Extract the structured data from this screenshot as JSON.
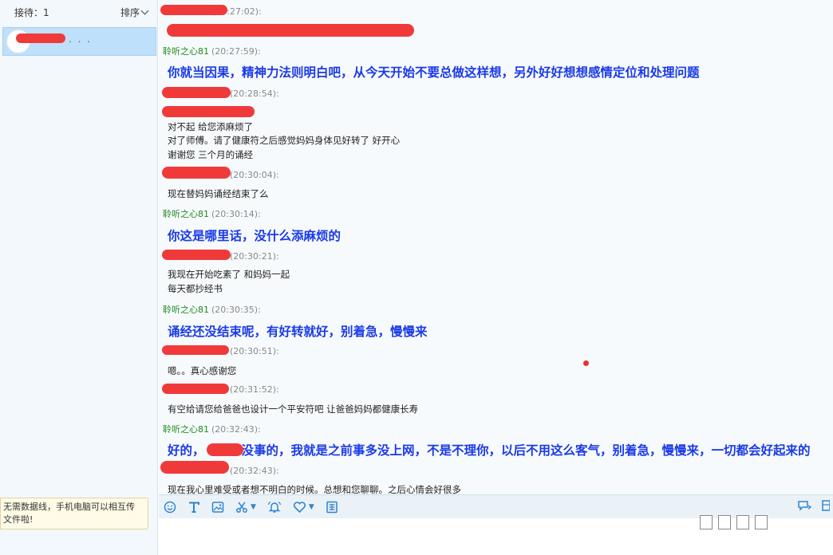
{
  "sidebar": {
    "reception_label": "接待：1",
    "sort_label": "排序",
    "contact_dots": ". . .",
    "tip_text": "无需数据线，手机电脑可以相互传文件啦!"
  },
  "messages": [
    {
      "sender": "",
      "time": "(20:27:02):",
      "lines": [],
      "big": []
    },
    {
      "sender": "聆听之心81",
      "time": "(20:27:59):",
      "lines": [],
      "big": [
        "你就当因果，精神力法则明白吧，从今天开始不要总做这样想，另外好好想想感情定位和处理问题"
      ]
    },
    {
      "sender": "",
      "time": "(20:28:54):",
      "lines": [
        "对不起 给您添麻烦了",
        "对了师傅。请了健康符之后感觉妈妈身体见好转了 好开心",
        "谢谢您 三个月的诵经"
      ],
      "big": []
    },
    {
      "sender": "",
      "time": "(20:30:04):",
      "lines": [
        "现在替妈妈诵经结束了么"
      ],
      "big": []
    },
    {
      "sender": "聆听之心81",
      "time": "(20:30:14):",
      "lines": [],
      "big": [
        "你这是哪里话，没什么添麻烦的"
      ]
    },
    {
      "sender": "",
      "time": "(20:30:21):",
      "lines": [
        "我现在开始吃素了 和妈妈一起",
        "每天都抄经书"
      ],
      "big": []
    },
    {
      "sender": "聆听之心81",
      "time": "(20:30:35):",
      "lines": [],
      "big": [
        "诵经还没结束呢，有好转就好，别着急，慢慢来"
      ]
    },
    {
      "sender": "",
      "time": "(20:30:51):",
      "lines": [
        "嗯。。真心感谢您"
      ],
      "big": []
    },
    {
      "sender": "",
      "time": "(20:31:52):",
      "lines": [
        "有空给请您给爸爸也设计一个平安符吧 让爸爸妈妈都健康长寿"
      ],
      "big": []
    },
    {
      "sender": "聆听之心81",
      "time": "(20:32:43):",
      "lines": [],
      "big": [
        "好的，",
        "没事的，我就是之前事多没上网，不是不理你，以后不用这么客气，别着急，慢慢来，一切都会好起来的"
      ]
    },
    {
      "sender": "",
      "time": "(20:32:43):",
      "lines": [
        "现在我心里难受或者想不明白的时候。总想和您聊聊。之后心情会好很多"
      ],
      "big": []
    }
  ],
  "icons": {
    "toolbar": [
      "smiley-icon",
      "font-icon",
      "image-icon",
      "scissors-icon",
      "bell-icon",
      "heart-icon",
      "keyboard-icon"
    ],
    "toolbar_right": [
      "chat-bubble-icon",
      "layout-icon"
    ]
  },
  "colors": {
    "sender_green": "#1f8a1f",
    "big_text_blue": "#1a3ae8",
    "selected_contact": "#bee0fa",
    "toolbar_icon": "#2f84d0"
  }
}
